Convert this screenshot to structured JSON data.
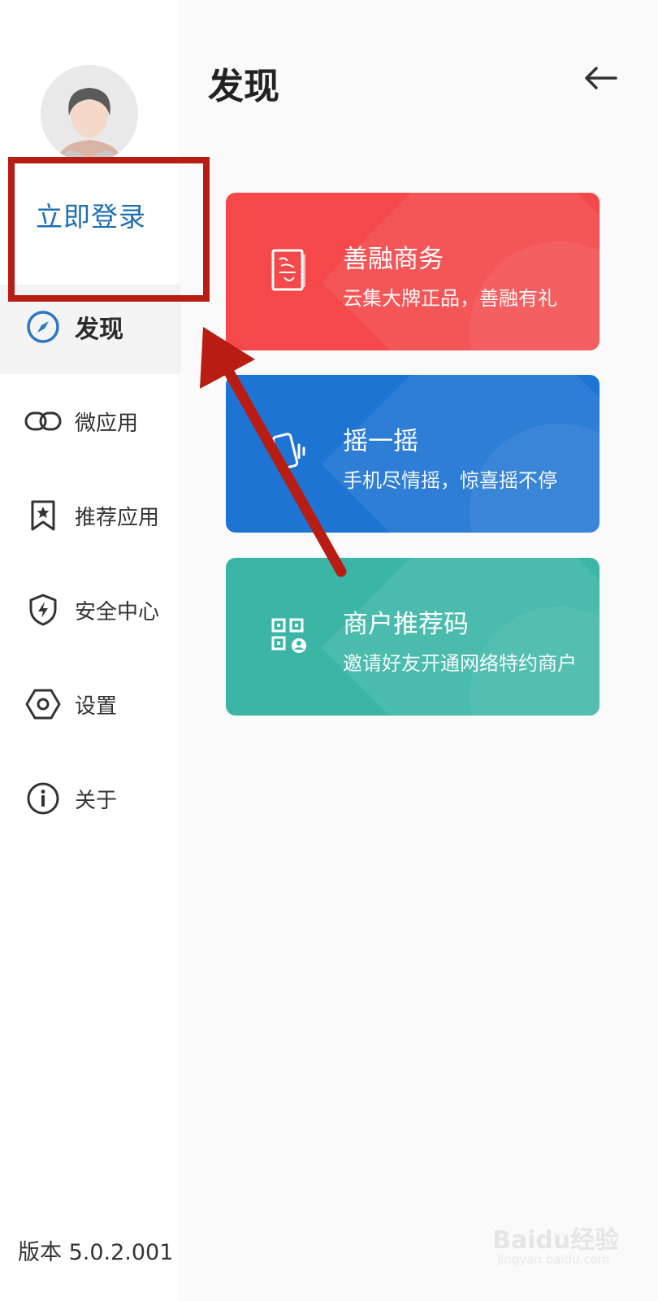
{
  "sidebar": {
    "login_label": "立即登录",
    "items": [
      {
        "label": "发现",
        "icon": "compass-icon"
      },
      {
        "label": "微应用",
        "icon": "link-icon"
      },
      {
        "label": "推荐应用",
        "icon": "bookmark-star-icon"
      },
      {
        "label": "安全中心",
        "icon": "shield-bolt-icon"
      },
      {
        "label": "设置",
        "icon": "settings-hexagon-icon"
      },
      {
        "label": "关于",
        "icon": "info-icon"
      }
    ],
    "version": "版本 5.0.2.001"
  },
  "header": {
    "title": "发现",
    "back_icon": "arrow-left-icon"
  },
  "cards": [
    {
      "title": "善融商务",
      "subtitle": "云集大牌正品，善融有礼",
      "color": "#f4484a",
      "icon": "stamp-icon"
    },
    {
      "title": "摇一摇",
      "subtitle": "手机尽情摇，惊喜摇不停",
      "color": "#1d74d2",
      "icon": "phone-shake-icon"
    },
    {
      "title": "商户推荐码",
      "subtitle": "邀请好友开通网络特约商户",
      "color": "#3bb6a6",
      "icon": "qr-code-user-icon"
    }
  ],
  "annotation": {
    "color": "#b81c13"
  },
  "watermark": {
    "brand": "Baidu经验",
    "site": "jingyan.baidu.com"
  }
}
